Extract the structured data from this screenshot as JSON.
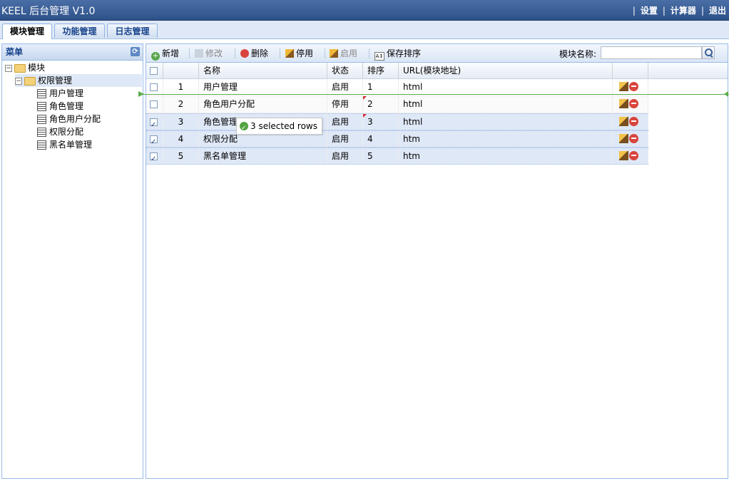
{
  "header": {
    "title": "KEEL 后台管理 V1.0",
    "links": [
      "设置",
      "计算器",
      "退出"
    ],
    "separator": "|"
  },
  "tabs": [
    {
      "label": "模块管理",
      "active": true
    },
    {
      "label": "功能管理",
      "active": false
    },
    {
      "label": "日志管理",
      "active": false
    }
  ],
  "sidebar": {
    "title": "菜单",
    "tree": {
      "root": "模块",
      "folder": "权限管理",
      "items": [
        "用户管理",
        "角色管理",
        "角色用户分配",
        "权限分配",
        "黑名单管理"
      ]
    }
  },
  "toolbar": {
    "add": "新增",
    "edit": "修改",
    "delete": "删除",
    "disable": "停用",
    "enable": "启用",
    "save_sort": "保存排序",
    "search_label": "模块名称:",
    "search_value": ""
  },
  "grid": {
    "columns": {
      "name": "名称",
      "status": "状态",
      "sort": "排序",
      "url": "URL(模块地址)"
    },
    "rows": [
      {
        "no": "1",
        "name": "用户管理",
        "status": "启用",
        "sort": "1",
        "url": "html",
        "checked": false
      },
      {
        "no": "2",
        "name": "角色用户分配",
        "status": "停用",
        "sort": "2",
        "url": "html",
        "checked": false
      },
      {
        "no": "3",
        "name": "角色管理",
        "status": "启用",
        "sort": "3",
        "url": "html",
        "checked": true
      },
      {
        "no": "4",
        "name": "权限分配",
        "status": "启用",
        "sort": "4",
        "url": "htm",
        "checked": true
      },
      {
        "no": "5",
        "name": "黑名单管理",
        "status": "启用",
        "sort": "5",
        "url": "htm",
        "checked": true
      }
    ]
  },
  "drag_tooltip": "3 selected rows",
  "colors": {
    "header": "#2d5189",
    "accent": "#99bbe8",
    "selection": "#dfe8f6",
    "guide": "#5aab4a"
  }
}
